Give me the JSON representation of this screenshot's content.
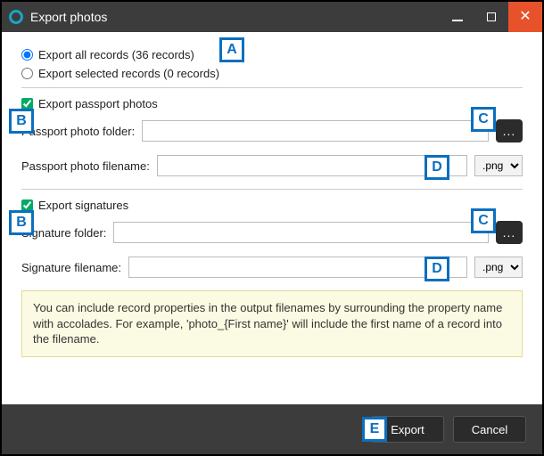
{
  "window": {
    "title": "Export photos"
  },
  "records": {
    "all_label": "Export all records (36 records)",
    "selected_label": "Export selected records (0 records)"
  },
  "passport": {
    "toggle_label": "Export passport photos",
    "folder_label": "Passport photo folder:",
    "folder_value": "",
    "filename_label": "Passport photo filename:",
    "filename_value": "",
    "ext": ".png"
  },
  "signature": {
    "toggle_label": "Export signatures",
    "folder_label": "Signature folder:",
    "folder_value": "",
    "filename_label": "Signature filename:",
    "filename_value": "",
    "ext": ".png"
  },
  "browse_glyph": "...",
  "hint": "You can include record properties in the output filenames by surrounding the property name with accolades. For example, 'photo_{First name}' will include the first name of a record into the filename.",
  "buttons": {
    "export": "Export",
    "cancel": "Cancel"
  },
  "tags": {
    "A": "A",
    "B": "B",
    "C": "C",
    "D": "D",
    "E": "E"
  }
}
